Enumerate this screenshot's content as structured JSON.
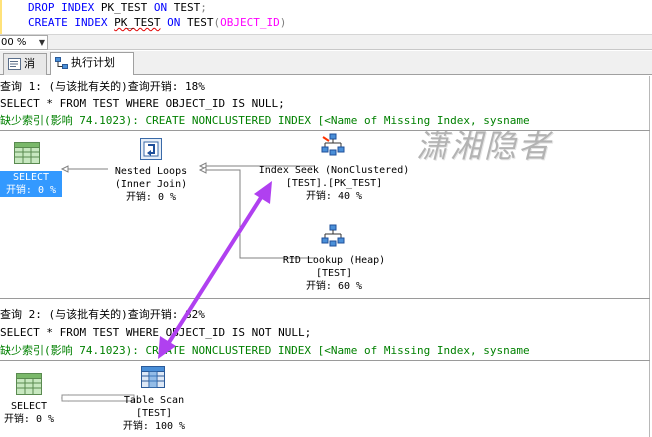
{
  "editor": {
    "line1": {
      "kw1": "DROP INDEX",
      "name": "PK_TEST",
      "kw2": "ON",
      "table": "TEST",
      "end": ";"
    },
    "line2": {
      "kw1": "CREATE INDEX",
      "name": "PK_TEST",
      "kw2": "ON",
      "table": "TEST",
      "open": "(",
      "col": "OBJECT_ID",
      "close": ")"
    }
  },
  "zoom": {
    "value": "00 %",
    "arrow": "▼"
  },
  "tabs": [
    {
      "label": "消息"
    },
    {
      "label": "执行计划"
    }
  ],
  "query1": {
    "header": "查询 1: (与该批有关的)查询开销: 18%",
    "sql": "SELECT * FROM TEST WHERE OBJECT_ID IS NULL;",
    "missing_prefix": "缺少索引(影响 74.1023): ",
    "missing_text": "CREATE NONCLUSTERED INDEX [<Name of Missing Index, sysname"
  },
  "query2": {
    "header": "查询 2: (与该批有关的)查询开销: 82%",
    "sql": "SELECT * FROM TEST WHERE OBJECT_ID IS NOT NULL;",
    "missing_prefix": "缺少索引(影响 74.1023): ",
    "missing_text": "CREATE NONCLUSTERED INDEX [<Name of Missing Index, sysname"
  },
  "plan1": {
    "select": {
      "name": "SELECT",
      "cost": "开销: 0 %"
    },
    "nested_loops": {
      "name": "Nested Loops",
      "sub": "(Inner Join)",
      "cost": "开销: 0 %"
    },
    "index_seek": {
      "name": "Index Seek (NonClustered)",
      "sub": "[TEST].[PK_TEST]",
      "cost": "开销: 40 %"
    },
    "rid_lookup": {
      "name": "RID Lookup (Heap)",
      "sub": "[TEST]",
      "cost": "开销: 60 %"
    }
  },
  "plan2": {
    "select": {
      "name": "SELECT",
      "cost": "开销: 0 %"
    },
    "table_scan": {
      "name": "Table Scan",
      "sub": "[TEST]",
      "cost": "开销: 100 %"
    }
  },
  "watermark": "潇湘隐者",
  "colors": {
    "keyword": "#0000ff",
    "function": "#ff00ff",
    "missing": "#008000",
    "selection": "#3399ff",
    "arrow": "#b040f0"
  }
}
